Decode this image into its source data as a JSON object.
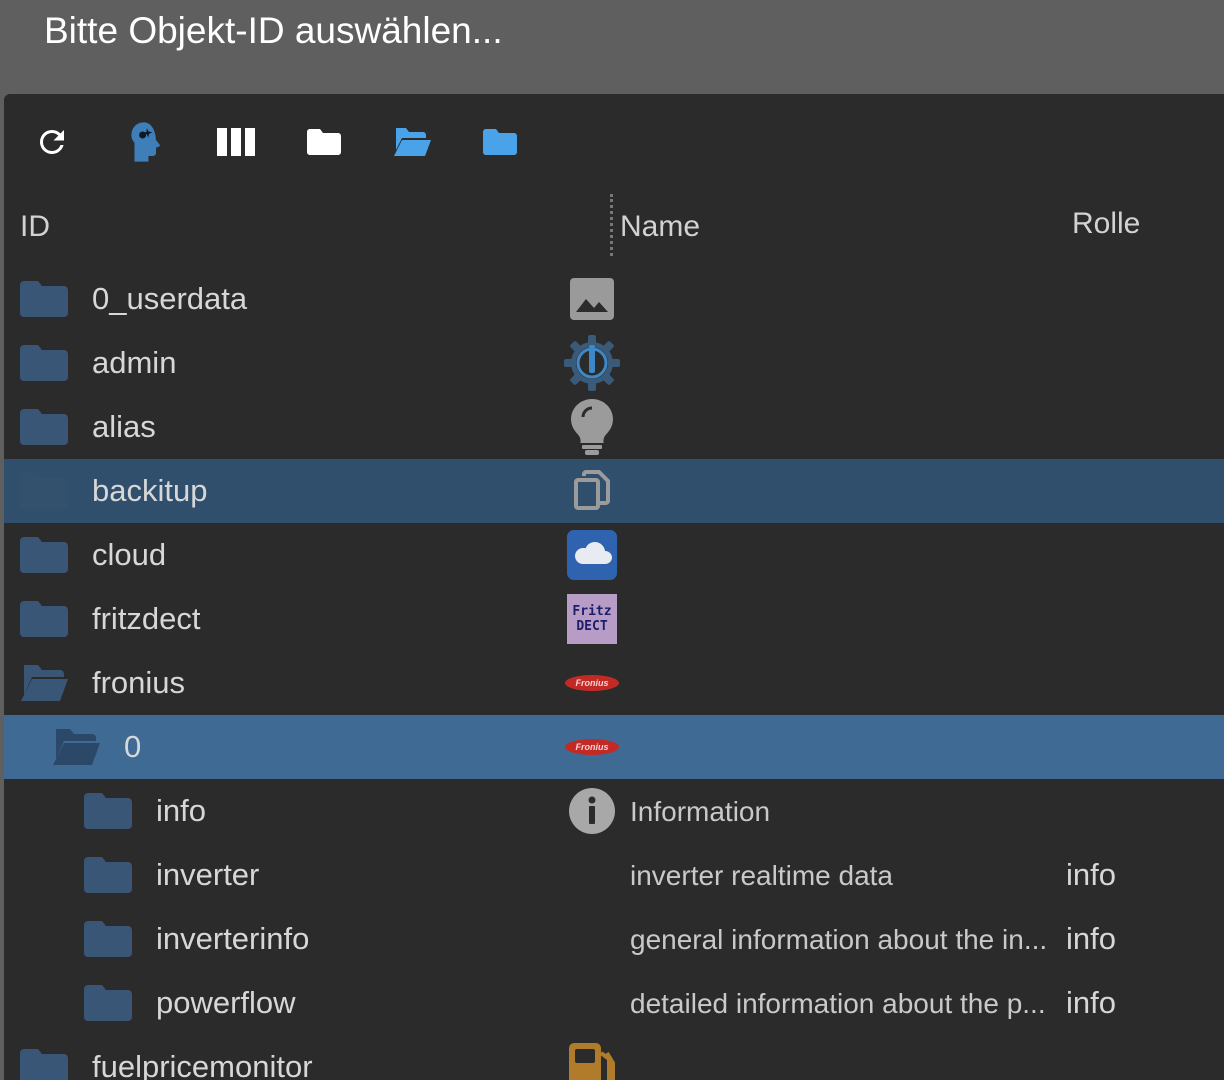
{
  "dialog": {
    "title": "Bitte Objekt-ID auswählen..."
  },
  "toolbar": {
    "buttons": [
      {
        "name": "refresh",
        "icon": "refresh-icon"
      },
      {
        "name": "expert-mode",
        "icon": "head-icon"
      },
      {
        "name": "columns",
        "icon": "columns-icon"
      },
      {
        "name": "collapse-all",
        "icon": "folder-closed-icon"
      },
      {
        "name": "expand-all",
        "icon": "folder-open-icon"
      },
      {
        "name": "expand-one-level",
        "icon": "folder-icon"
      }
    ]
  },
  "columns": {
    "id": "ID",
    "name": "Name",
    "role": "Rolle"
  },
  "colors": {
    "folder": "#3a5676",
    "folder_active": "#2b4869",
    "selected_row": "#2f4f6c",
    "active_row": "#3e6a94",
    "toolbar_blue": "#4aa3e8"
  },
  "rows": [
    {
      "id": "0_userdata",
      "name": "",
      "role": "",
      "icon": "image-icon",
      "folder": "closed"
    },
    {
      "id": "admin",
      "name": "",
      "role": "",
      "icon": "iobroker-gear-icon",
      "folder": "closed"
    },
    {
      "id": "alias",
      "name": "",
      "role": "",
      "icon": "lightbulb-icon",
      "folder": "closed"
    },
    {
      "id": "backitup",
      "name": "",
      "role": "",
      "icon": "copy-icon",
      "folder": "closed"
    },
    {
      "id": "cloud",
      "name": "",
      "role": "",
      "icon": "cloud-icon",
      "folder": "closed"
    },
    {
      "id": "fritzdect",
      "name": "",
      "role": "",
      "icon": "fritz-dect-icon",
      "icon_text": [
        "Fritz",
        "DECT"
      ],
      "folder": "closed"
    },
    {
      "id": "fronius",
      "name": "",
      "role": "",
      "icon": "fronius-logo-icon",
      "icon_text": "Fronius",
      "folder": "open"
    },
    {
      "id": "0",
      "name": "",
      "role": "",
      "icon": "fronius-logo-icon",
      "icon_text": "Fronius",
      "folder": "open"
    },
    {
      "id": "info",
      "name": "Information",
      "role": "",
      "icon": "info-icon",
      "folder": "closed"
    },
    {
      "id": "inverter",
      "name": "inverter realtime data",
      "role": "info",
      "icon": "",
      "folder": "closed"
    },
    {
      "id": "inverterinfo",
      "name": "general information about the in...",
      "role": "info",
      "icon": "",
      "folder": "closed"
    },
    {
      "id": "powerflow",
      "name": "detailed information about the p...",
      "role": "info",
      "icon": "",
      "folder": "closed"
    },
    {
      "id": "fuelpricemonitor",
      "name": "",
      "role": "",
      "icon": "fuel-pump-icon",
      "folder": "closed"
    }
  ]
}
